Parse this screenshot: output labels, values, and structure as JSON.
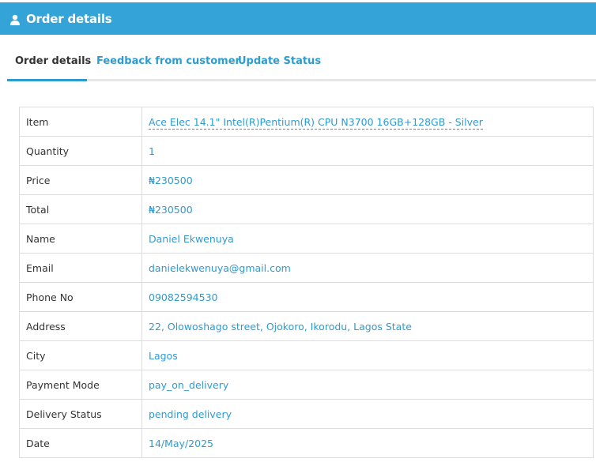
{
  "header": {
    "title": "Order details",
    "icon": "user-icon",
    "color": "#33a3d8"
  },
  "tabs": [
    {
      "label": "Order details",
      "active": true
    },
    {
      "label": "Feedback from customer",
      "active": false
    },
    {
      "label": "Update Status",
      "active": false
    }
  ],
  "order": {
    "rows": [
      {
        "label": "Item",
        "value": "Ace Elec 14.1\" Intel(R)Pentium(R) CPU N3700 16GB+128GB - Silver"
      },
      {
        "label": "Quantity",
        "value": "1"
      },
      {
        "label": "Price",
        "value": "₦230500"
      },
      {
        "label": "Total",
        "value": "₦230500"
      },
      {
        "label": "Name",
        "value": "Daniel Ekwenuya"
      },
      {
        "label": "Email",
        "value": "danielekwenuya@gmail.com"
      },
      {
        "label": "Phone No",
        "value": "09082594530"
      },
      {
        "label": "Address",
        "value": "22, Olowoshago street, Ojokoro, Ikorodu, Lagos State"
      },
      {
        "label": "City",
        "value": "Lagos"
      },
      {
        "label": "Payment Mode",
        "value": "pay_on_delivery"
      },
      {
        "label": "Delivery Status",
        "value": "pending delivery"
      },
      {
        "label": "Date",
        "value": "14/May/2025"
      }
    ]
  },
  "colors": {
    "accent": "#2e9bd0",
    "text": "#333333",
    "border": "#dcdcdc"
  }
}
